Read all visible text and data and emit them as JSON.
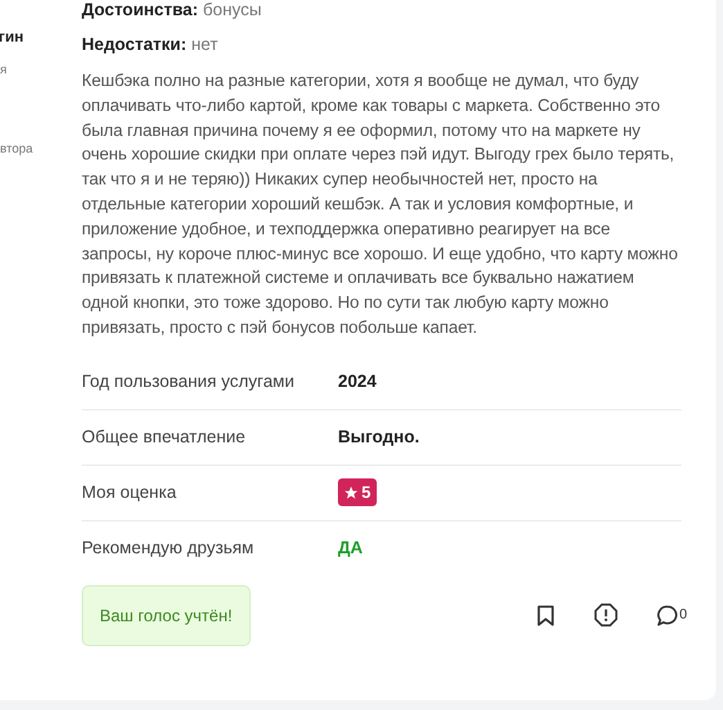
{
  "sidebar": {
    "author_name": "гин",
    "author_status": "я",
    "author_note": "втора"
  },
  "review": {
    "pros_label": "Достоинства:",
    "pros": "бонусы",
    "cons_label": "Недостатки:",
    "cons": "нет",
    "text": "Кешбэка полно на разные категории, хотя я вообще не думал, что буду оплачивать что-либо картой, кроме как товары с маркета. Собственно это была главная причина почему я ее оформил, потому что на маркете ну очень хорошие скидки при оплате через пэй идут. Выгоду грех было терять, так что я и не теряю)) Никаких супер необычностей нет, просто на отдельные категории хороший кешбэк. А так и условия комфортные, и приложение удобное, и техподдержка оперативно реагирует на все запросы, ну короче плюс-минус все хорошо. И еще удобно, что карту можно привязать к платежной системе и оплачивать все буквально нажатием одной кнопки, это тоже здорово. Но по сути так любую карту можно привязать, просто с пэй бонусов побольше капает."
  },
  "details": [
    {
      "kind": "text",
      "label": "Год пользования услугами",
      "value": "2024"
    },
    {
      "kind": "text",
      "label": "Общее впечатление",
      "value": "Выгодно."
    },
    {
      "kind": "rating",
      "label": "Моя оценка",
      "value": "5"
    },
    {
      "kind": "recommend",
      "label": "Рекомендую друзьям",
      "value": "ДА"
    }
  ],
  "vote_message": "Ваш голос учтён!",
  "comment_count": "0"
}
